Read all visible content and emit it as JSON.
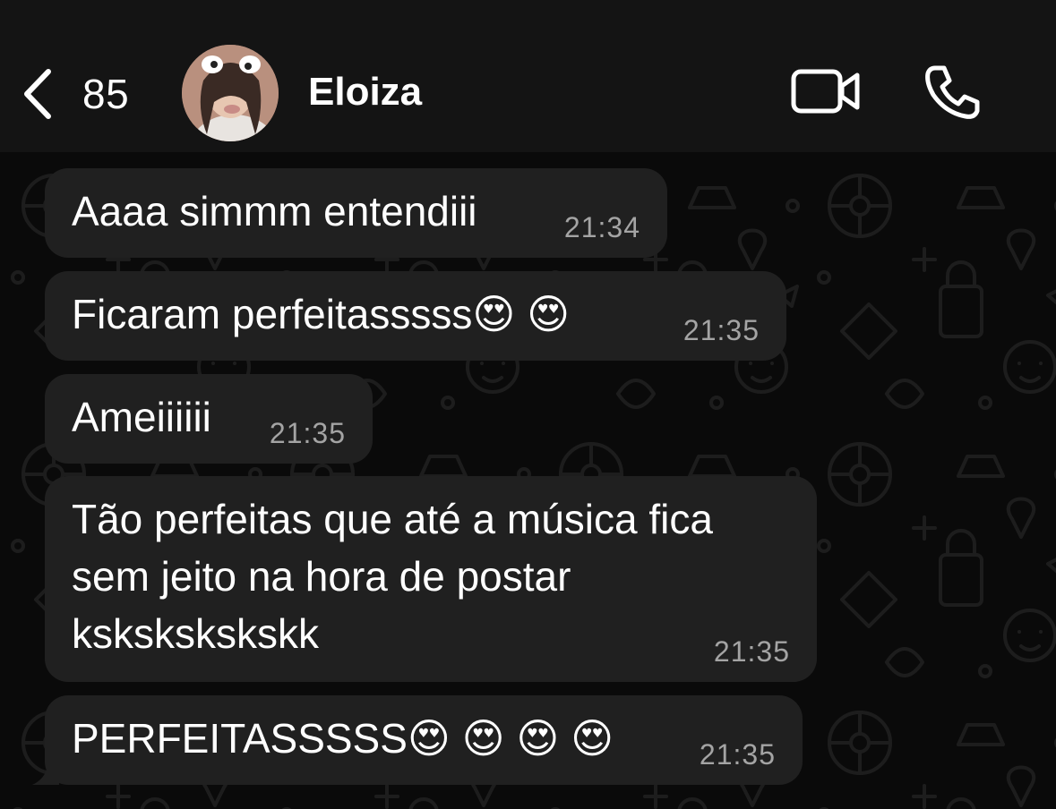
{
  "header": {
    "unread_count": "85",
    "contact_name": "Eloiza",
    "back_icon": "chevron-left-icon",
    "video_icon": "video-camera-icon",
    "call_icon": "phone-icon"
  },
  "messages": [
    {
      "text": "Aaaa simmm entendiii",
      "time": "21:34"
    },
    {
      "text": "Ficaram perfeitasssss😍 😍",
      "time": "21:35"
    },
    {
      "text": "Ameiiiiii",
      "time": "21:35"
    },
    {
      "text": "Tão perfeitas que até a música fica\nsem jeito na hora de postar\nkskskskskskk",
      "time": "21:35"
    },
    {
      "text": "PERFEITASSSSS😍 😍 😍 😍",
      "time": "21:35"
    }
  ],
  "colors": {
    "header_bg": "#141414",
    "bubble_bg": "#202020",
    "timestamp": "#a4a4a4",
    "wallpaper_doodle": "#1d1d1d"
  }
}
